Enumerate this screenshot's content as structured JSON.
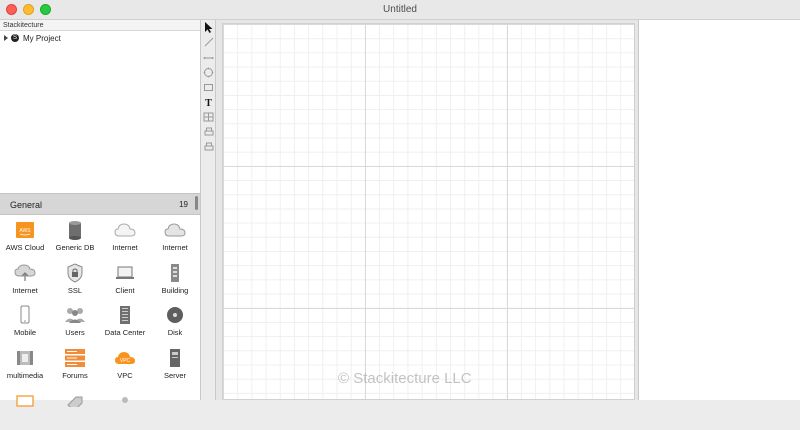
{
  "window": {
    "title": "Untitled"
  },
  "sidebar": {
    "header": "Stackitecture",
    "tree": [
      {
        "label": "My Project",
        "icon": "project-icon"
      }
    ]
  },
  "library": {
    "title": "General",
    "count": "19",
    "items": [
      {
        "label": "AWS Cloud",
        "icon": "aws-cloud-icon"
      },
      {
        "label": "Generic DB",
        "icon": "database-icon"
      },
      {
        "label": "Internet",
        "icon": "cloud-icon"
      },
      {
        "label": "Internet",
        "icon": "cloud-icon"
      },
      {
        "label": "Internet",
        "icon": "cloud-upload-icon"
      },
      {
        "label": "SSL",
        "icon": "shield-lock-icon"
      },
      {
        "label": "Client",
        "icon": "laptop-icon"
      },
      {
        "label": "Building",
        "icon": "building-icon"
      },
      {
        "label": "Mobile",
        "icon": "mobile-phone-icon"
      },
      {
        "label": "Users",
        "icon": "users-icon"
      },
      {
        "label": "Data Center",
        "icon": "server-rack-icon"
      },
      {
        "label": "Disk",
        "icon": "disk-icon"
      },
      {
        "label": "multimedia",
        "icon": "multimedia-icon"
      },
      {
        "label": "Forums",
        "icon": "forums-icon"
      },
      {
        "label": "VPC",
        "icon": "vpc-cloud-icon"
      },
      {
        "label": "Server",
        "icon": "server-icon"
      }
    ]
  },
  "tools": [
    {
      "name": "pointer-tool",
      "icon": "arrow-pointer-icon"
    },
    {
      "name": "line-tool",
      "icon": "line-icon"
    },
    {
      "name": "connector-tool",
      "icon": "connector-icon"
    },
    {
      "name": "ellipse-tool",
      "icon": "circle-icon"
    },
    {
      "name": "rectangle-tool",
      "icon": "rectangle-icon"
    },
    {
      "name": "text-tool",
      "icon": "text-icon"
    },
    {
      "name": "table-tool",
      "icon": "table-icon"
    },
    {
      "name": "print-tool",
      "icon": "printer-icon"
    },
    {
      "name": "print-alt-tool",
      "icon": "printer-icon"
    }
  ],
  "canvas": {
    "watermark": "© Stackitecture LLC"
  },
  "colors": {
    "accent": "#f7931e",
    "grid_major": "#d9d9d9",
    "grid_minor": "#efefef"
  }
}
